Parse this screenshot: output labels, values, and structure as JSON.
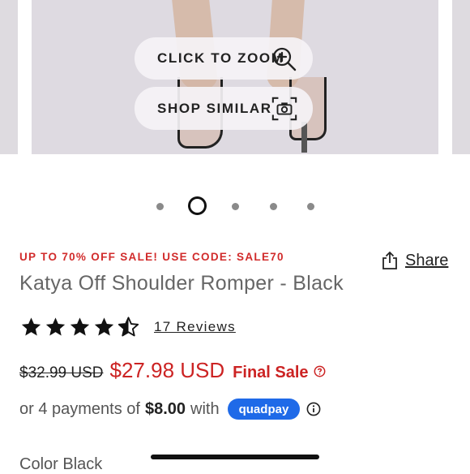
{
  "gallery": {
    "zoom_button_label": "CLICK TO ZOOM",
    "zoom_icon": "zoom-in-icon",
    "similar_button_label": "SHOP SIMILAR",
    "similar_icon": "camera-icon",
    "pagination": {
      "total": 5,
      "active_index": 1
    }
  },
  "product": {
    "promo_text": "UP TO 70% OFF SALE! USE CODE: SALE70",
    "share_label": "Share",
    "title": "Katya Off Shoulder Romper - Black",
    "rating": 4.5,
    "reviews_label": "17 Reviews",
    "original_price": "$32.99 USD",
    "sale_price": "$27.98 USD",
    "final_sale_label": "Final Sale",
    "payments_prefix": "or 4 payments of",
    "payment_amount": "$8.00",
    "payments_suffix": "with",
    "quadpay_label": "quadpay",
    "color_label": "Color Black"
  },
  "colors": {
    "sale_red": "#cc2323",
    "quadpay_blue": "#1f6ae8"
  }
}
